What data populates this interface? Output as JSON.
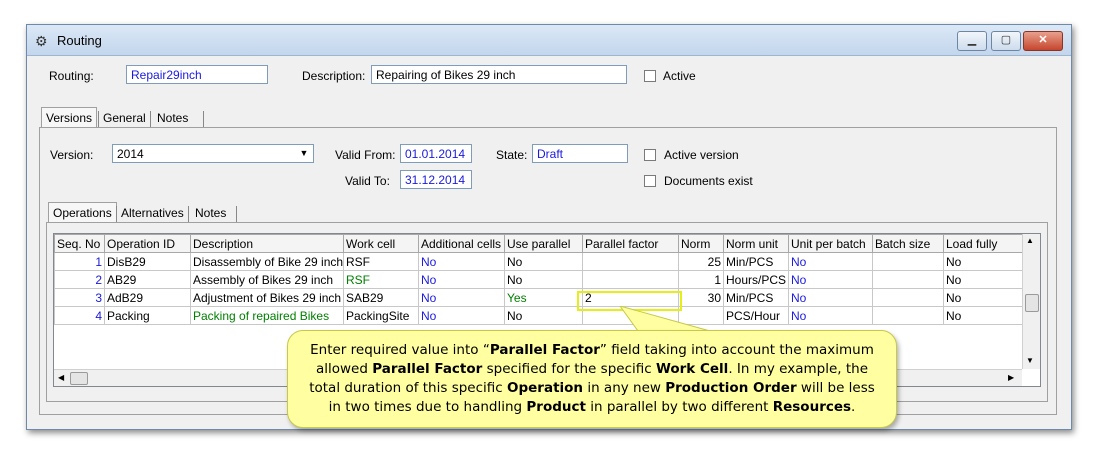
{
  "window": {
    "title": "Routing",
    "icon": "gear-icon"
  },
  "header": {
    "routing_label": "Routing:",
    "routing_value": "Repair29inch",
    "description_label": "Description:",
    "description_value": "Repairing of Bikes 29 inch",
    "active_label": "Active"
  },
  "main_tabs": [
    "Versions",
    "General",
    "Notes"
  ],
  "versions": {
    "version_label": "Version:",
    "version_value": "2014",
    "valid_from_label": "Valid From:",
    "valid_from_value": "01.01.2014",
    "valid_to_label": "Valid To:",
    "valid_to_value": "31.12.2014",
    "state_label": "State:",
    "state_value": "Draft",
    "active_version_label": "Active version",
    "documents_exist_label": "Documents exist"
  },
  "sub_tabs": [
    "Operations",
    "Alternatives",
    "Notes"
  ],
  "table": {
    "columns": [
      "Seq. No",
      "Operation ID",
      "Description",
      "Work cell",
      "Additional cells",
      "Use parallel",
      "Parallel factor",
      "Norm",
      "Norm unit",
      "Unit per batch",
      "Batch size",
      "Load fully"
    ],
    "rows": [
      [
        "1",
        "DisB29",
        "Disassembly of Bike 29 inch",
        "RSF",
        "No",
        "No",
        "",
        "25",
        "Min/PCS",
        "No",
        "",
        "No"
      ],
      [
        "2",
        "AB29",
        "Assembly of Bikes 29 inch",
        "RSF",
        "No",
        "No",
        "",
        "1",
        "Hours/PCS",
        "No",
        "",
        "No"
      ],
      [
        "3",
        "AdB29",
        "Adjustment of Bikes 29 inch",
        "SAB29",
        "No",
        "Yes",
        "2",
        "30",
        "Min/PCS",
        "No",
        "",
        "No"
      ],
      [
        "4",
        "Packing",
        "Packing of repaired Bikes",
        "PackingSite",
        "No",
        "No",
        "",
        "",
        "PCS/Hour",
        "No",
        "",
        "No"
      ]
    ]
  },
  "callout": {
    "line1_a": "Enter required value into “",
    "line1_b": "Parallel Factor",
    "line1_c": "” field taking into account the maximum",
    "line2_a": "allowed ",
    "line2_b": "Parallel Factor",
    "line2_c": " specified for the specific ",
    "line2_d": "Work Cell",
    "line2_e": ". In my example, the",
    "line3_a": "total duration of this specific ",
    "line3_b": "Operation",
    "line3_c": " in any new ",
    "line3_d": "Production Order",
    "line3_e": " will be less",
    "line4_a": "in two times due to handling ",
    "line4_b": "Product",
    "line4_c": " in parallel by two different ",
    "line4_d": "Resources",
    "line4_e": "."
  }
}
